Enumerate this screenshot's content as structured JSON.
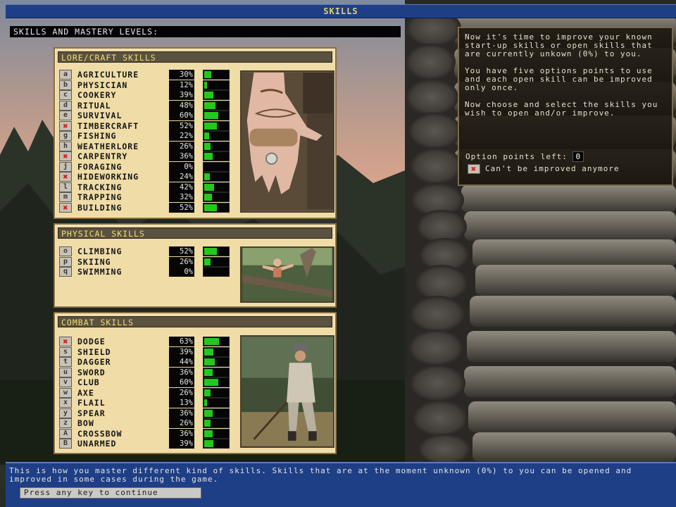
{
  "window": {
    "title": "SKILLS"
  },
  "header": {
    "title": "SKILLS AND MASTERY LEVELS:"
  },
  "lore": {
    "title": "LORE/CRAFT SKILLS",
    "skills": [
      {
        "key": "a",
        "name": "AGRICULTURE",
        "pct": "30%",
        "level": 30,
        "maxed": false
      },
      {
        "key": "b",
        "name": "PHYSICIAN",
        "pct": "12%",
        "level": 12,
        "maxed": false
      },
      {
        "key": "c",
        "name": "COOKERY",
        "pct": "39%",
        "level": 39,
        "maxed": false
      },
      {
        "key": "d",
        "name": "RITUAL",
        "pct": "48%",
        "level": 48,
        "maxed": false
      },
      {
        "key": "e",
        "name": "SURVIVAL",
        "pct": "60%",
        "level": 60,
        "maxed": false
      },
      {
        "key": "",
        "name": "TIMBERCRAFT",
        "pct": "52%",
        "level": 52,
        "maxed": true
      },
      {
        "key": "g",
        "name": "FISHING",
        "pct": "22%",
        "level": 22,
        "maxed": false
      },
      {
        "key": "h",
        "name": "WEATHERLORE",
        "pct": "26%",
        "level": 26,
        "maxed": false
      },
      {
        "key": "",
        "name": "CARPENTRY",
        "pct": "36%",
        "level": 36,
        "maxed": true
      },
      {
        "key": "j",
        "name": "FORAGING",
        "pct": "0%",
        "level": 0,
        "maxed": false
      },
      {
        "key": "",
        "name": "HIDEWORKING",
        "pct": "24%",
        "level": 24,
        "maxed": true
      },
      {
        "key": "l",
        "name": "TRACKING",
        "pct": "42%",
        "level": 42,
        "maxed": false
      },
      {
        "key": "m",
        "name": "TRAPPING",
        "pct": "32%",
        "level": 32,
        "maxed": false
      },
      {
        "key": "",
        "name": "BUILDING",
        "pct": "52%",
        "level": 52,
        "maxed": true
      }
    ]
  },
  "physical": {
    "title": "PHYSICAL SKILLS",
    "skills": [
      {
        "key": "o",
        "name": "CLIMBING",
        "pct": "52%",
        "level": 52,
        "maxed": false
      },
      {
        "key": "p",
        "name": "SKIING",
        "pct": "26%",
        "level": 26,
        "maxed": false
      },
      {
        "key": "q",
        "name": "SWIMMING",
        "pct": "0%",
        "level": 0,
        "maxed": false
      }
    ]
  },
  "combat": {
    "title": "COMBAT SKILLS",
    "skills": [
      {
        "key": "",
        "name": "DODGE",
        "pct": "63%",
        "level": 63,
        "maxed": true
      },
      {
        "key": "s",
        "name": "SHIELD",
        "pct": "39%",
        "level": 39,
        "maxed": false
      },
      {
        "key": "t",
        "name": "DAGGER",
        "pct": "44%",
        "level": 44,
        "maxed": false
      },
      {
        "key": "u",
        "name": "SWORD",
        "pct": "36%",
        "level": 36,
        "maxed": false
      },
      {
        "key": "v",
        "name": "CLUB",
        "pct": "60%",
        "level": 60,
        "maxed": false
      },
      {
        "key": "w",
        "name": "AXE",
        "pct": "26%",
        "level": 26,
        "maxed": false
      },
      {
        "key": "x",
        "name": "FLAIL",
        "pct": "13%",
        "level": 13,
        "maxed": false
      },
      {
        "key": "y",
        "name": "SPEAR",
        "pct": "36%",
        "level": 36,
        "maxed": false
      },
      {
        "key": "z",
        "name": "BOW",
        "pct": "26%",
        "level": 26,
        "maxed": false
      },
      {
        "key": "A",
        "name": "CROSSBOW",
        "pct": "36%",
        "level": 36,
        "maxed": false
      },
      {
        "key": "B",
        "name": "UNARMED",
        "pct": "39%",
        "level": 39,
        "maxed": false
      }
    ]
  },
  "info": {
    "p1": "Now it's time to improve your known start-up skills or open skills that are currently unkown (0%) to you.",
    "p2": "You have five options points to use and each open skill can be improved only once.",
    "p3": "Now choose and select the skills you wish to open and/or improve.",
    "option_label": "Option points left:",
    "option_value": "0",
    "legend_text": "Can't be improved anymore"
  },
  "footer": {
    "text": "This is how you master different kind of skills. Skills that are at the moment unknown (0%) to you can be opened and improved in some cases during the game.",
    "continue_label": "Press any key to continue"
  },
  "colors": {
    "bar_fill": "#22c81e",
    "maxed_mark": "#d01f1f",
    "title_text": "#e2d36a",
    "panel_bg": "#efdca7",
    "ui_blue": "#1e3f86"
  },
  "icons": {
    "maxed": "x-mark-icon"
  }
}
